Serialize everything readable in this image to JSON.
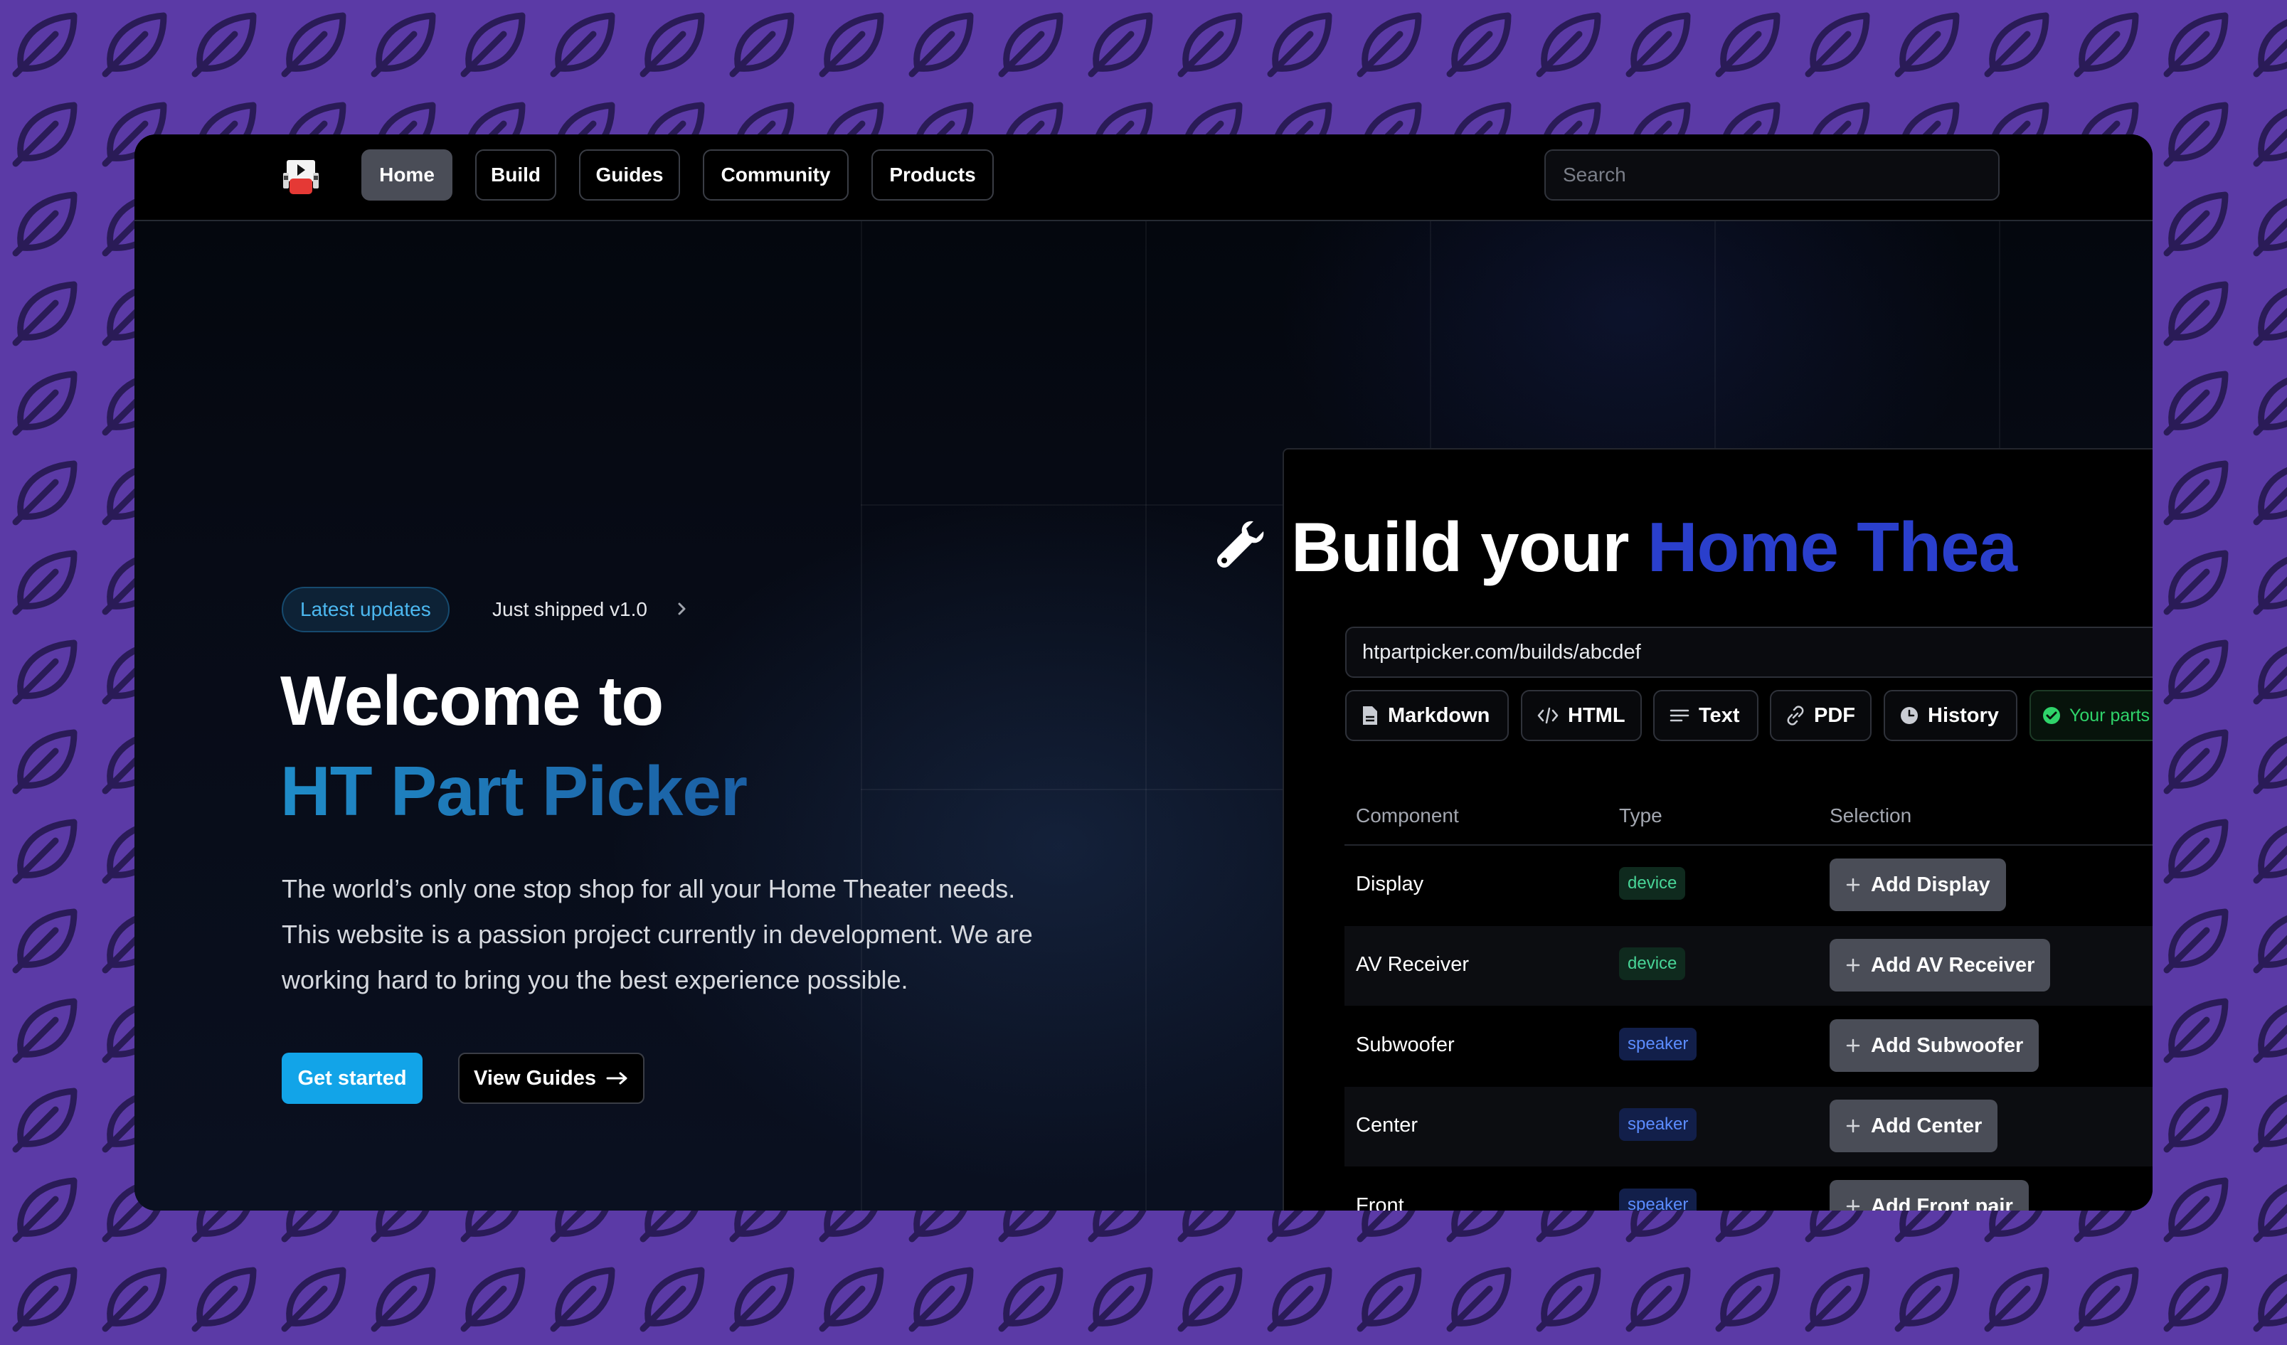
{
  "nav": {
    "items": [
      {
        "label": "Home",
        "active": true
      },
      {
        "label": "Build",
        "active": false
      },
      {
        "label": "Guides",
        "active": false
      },
      {
        "label": "Community",
        "active": false
      },
      {
        "label": "Products",
        "active": false
      }
    ],
    "search_placeholder": "Search"
  },
  "hero": {
    "badge": "Latest updates",
    "announcement": "Just shipped v1.0",
    "title_line1": "Welcome to",
    "title_line2": "HT Part Picker",
    "description": [
      "The world’s only one stop shop for all your Home Theater needs.",
      "This website is a passion project currently in development. We are",
      "working hard to bring you the best experience possible."
    ],
    "primary_cta": "Get started",
    "secondary_cta": "View Guides"
  },
  "builder": {
    "title_plain": "Build your ",
    "title_accent": "Home Thea",
    "url": "htpartpicker.com/builds/abcdef",
    "formats": [
      {
        "label": "Markdown",
        "icon": "file-icon"
      },
      {
        "label": "HTML",
        "icon": "code-icon"
      },
      {
        "label": "Text",
        "icon": "text-lines-icon"
      },
      {
        "label": "PDF",
        "icon": "link-icon"
      },
      {
        "label": "History",
        "icon": "clock-icon"
      }
    ],
    "saved_badge": "Your parts",
    "table": {
      "headers": [
        "Component",
        "Type",
        "Selection"
      ],
      "rows": [
        {
          "component": "Display",
          "type": "device",
          "action": "Add Display"
        },
        {
          "component": "AV Receiver",
          "type": "device",
          "action": "Add AV Receiver"
        },
        {
          "component": "Subwoofer",
          "type": "speaker",
          "action": "Add Subwoofer"
        },
        {
          "component": "Center",
          "type": "speaker",
          "action": "Add Center"
        },
        {
          "component": "Front",
          "type": "speaker",
          "action": "Add Front pair"
        }
      ]
    }
  },
  "colors": {
    "page_background": "#5b3aa6",
    "accent_cyan": "#12a4e8",
    "title_blue": "#2a3fcc",
    "device_tag": "#48d597",
    "speaker_tag": "#5b8cff",
    "success_green": "#2fd36a"
  }
}
